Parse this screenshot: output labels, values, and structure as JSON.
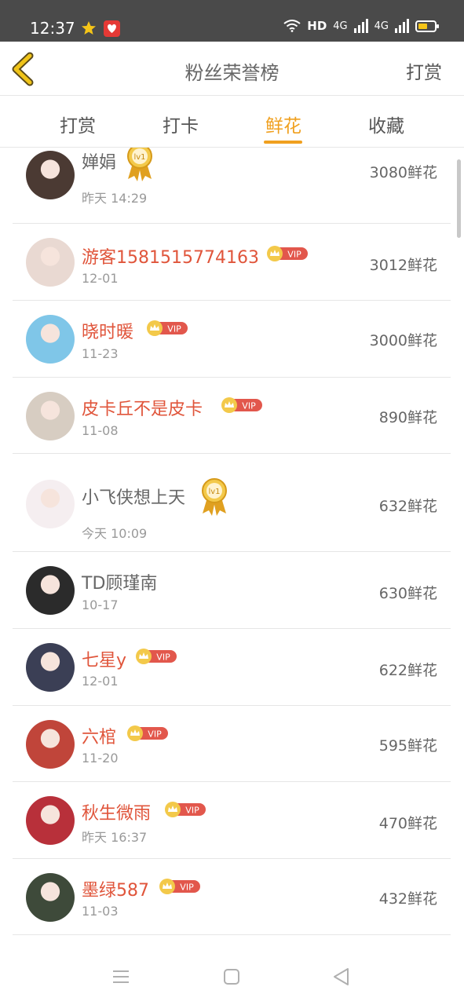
{
  "status_bar": {
    "time": "12:37",
    "network": "HD",
    "signal1": "4G",
    "signal2": "4G"
  },
  "header": {
    "title": "粉丝荣誉榜",
    "action": "打赏"
  },
  "tabs": [
    {
      "label": "打赏"
    },
    {
      "label": "打卡"
    },
    {
      "label": "鲜花",
      "active": true
    },
    {
      "label": "收藏"
    }
  ],
  "badges": {
    "vip": "VIP",
    "level": "lv1"
  },
  "list": [
    {
      "name": "婵娟",
      "time": "昨天 14:29",
      "amount": "3080鲜花",
      "badge": "medal",
      "avatar_color": "#4b3a33"
    },
    {
      "name": "游客1581515774163",
      "time": "12-01",
      "amount": "3012鲜花",
      "badge": "vip",
      "avatar_color": "#e9d9d2"
    },
    {
      "name": "晓时暖",
      "time": "11-23",
      "amount": "3000鲜花",
      "badge": "vip",
      "avatar_color": "#7fc6e8"
    },
    {
      "name": "皮卡丘不是皮卡",
      "time": "11-08",
      "amount": "890鲜花",
      "badge": "vip",
      "avatar_color": "#d7cdc2"
    },
    {
      "name": "小飞侠想上天",
      "time": "今天 10:09",
      "amount": "632鲜花",
      "badge": "medal",
      "avatar_color": "#f5eef0"
    },
    {
      "name": "TD顾瑾南",
      "time": "10-17",
      "amount": "630鲜花",
      "badge": "none",
      "avatar_color": "#2b2b2b"
    },
    {
      "name": "七星y",
      "time": "12-01",
      "amount": "622鲜花",
      "badge": "vip",
      "avatar_color": "#3b3f55"
    },
    {
      "name": "六棺",
      "time": "11-20",
      "amount": "595鲜花",
      "badge": "vip",
      "avatar_color": "#c0453a"
    },
    {
      "name": "秋生微雨",
      "time": "昨天 16:37",
      "amount": "470鲜花",
      "badge": "vip",
      "avatar_color": "#b8303a"
    },
    {
      "name": "墨绿587",
      "time": "11-03",
      "amount": "432鲜花",
      "badge": "vip",
      "avatar_color": "#3e4a3a"
    }
  ],
  "colors": {
    "accent": "#f0a01f",
    "vip_name": "#e0553b",
    "status_bar": "#4a4a4a"
  }
}
